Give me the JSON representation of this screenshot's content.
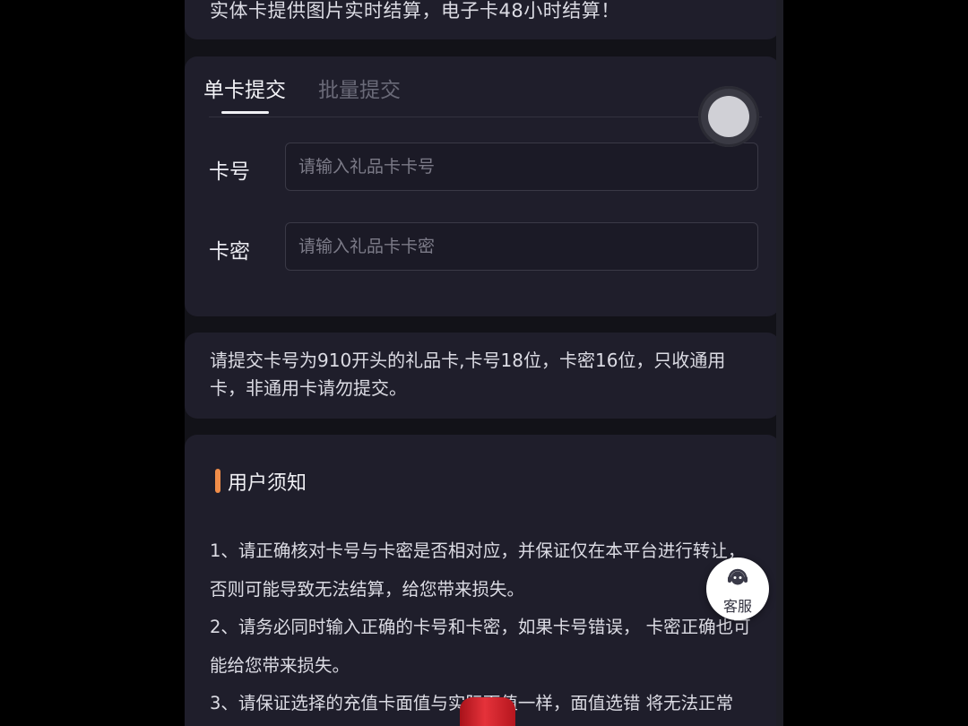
{
  "top_notice": "实体卡提供图片实时结算，电子卡48小时结算！",
  "tabs": [
    {
      "label": "单卡提交",
      "active": true
    },
    {
      "label": "批量提交",
      "active": false
    }
  ],
  "form": {
    "card_number_label": "卡号",
    "card_number_placeholder": "请输入礼品卡卡号",
    "card_password_label": "卡密",
    "card_password_placeholder": "请输入礼品卡卡密"
  },
  "submit_notice": "请提交卡号为910开头的礼品卡,卡号18位，卡密16位，只收通用卡，非通用卡请勿提交。",
  "user_notice": {
    "title": "用户须知",
    "items": [
      "1、请正确核对卡号与卡密是否相对应，并保证仅在本平台进行转让，否则可能导致无法结算，给您带来损失。",
      "2、请务必同时输入正确的卡号和卡密，如果卡号错误， 卡密正确也可能给您带来损失。",
      "3、请保证选择的充值卡面值与实际面值一样，面值选错 将无法正常"
    ]
  },
  "customer_service": {
    "label": "客服",
    "icon": "headset-icon"
  },
  "colors": {
    "accent": "#f08d49",
    "card_bg": "#1f1e2b",
    "page_bg": "#121218"
  }
}
